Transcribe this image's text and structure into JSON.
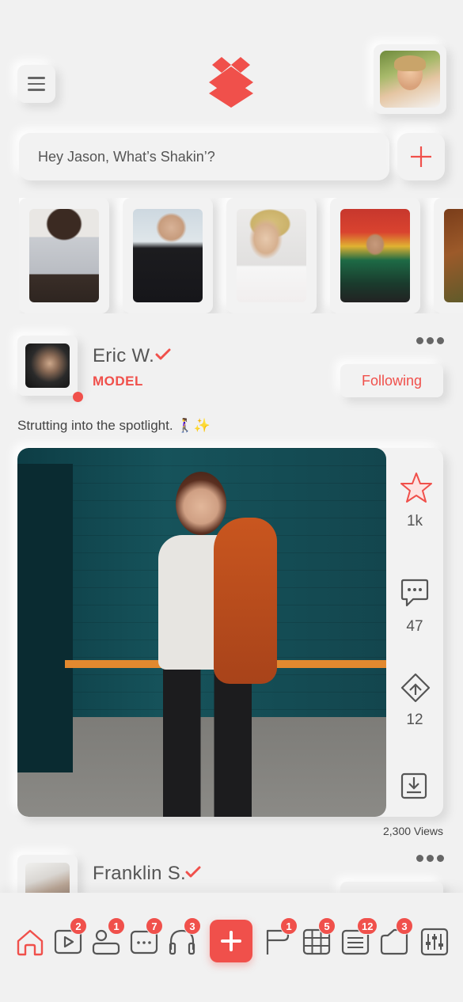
{
  "header": {
    "menu_icon": "hamburger-icon",
    "logo_icon": "stacked-diamonds-logo",
    "profile_avatar": "profile-avatar"
  },
  "search": {
    "placeholder": "Hey Jason, What’s Shakin’?",
    "add_icon": "plus-icon"
  },
  "stories": [
    {
      "name": "story-1"
    },
    {
      "name": "story-2"
    },
    {
      "name": "story-3"
    },
    {
      "name": "story-4"
    },
    {
      "name": "story-5"
    }
  ],
  "post": {
    "author": "Eric W.",
    "role": "MODEL",
    "follow_label": "Following",
    "caption": "Strutting into the spotlight. 🚶‍♀️✨",
    "stats": {
      "likes": "1k",
      "comments": "47",
      "shares": "12"
    },
    "views": "2,300 Views"
  },
  "post2": {
    "author": "Franklin S."
  },
  "bottom_nav": {
    "items": [
      {
        "name": "home",
        "badge": ""
      },
      {
        "name": "video",
        "badge": "2"
      },
      {
        "name": "people",
        "badge": "1"
      },
      {
        "name": "chat",
        "badge": "7"
      },
      {
        "name": "audio",
        "badge": "3"
      },
      {
        "name": "flag",
        "badge": "1"
      },
      {
        "name": "grid",
        "badge": "5"
      },
      {
        "name": "list",
        "badge": "12"
      },
      {
        "name": "folder",
        "badge": "3"
      },
      {
        "name": "settings",
        "badge": ""
      }
    ]
  },
  "colors": {
    "accent": "#f0504b",
    "background": "#f1f1f1",
    "text": "#444444"
  }
}
